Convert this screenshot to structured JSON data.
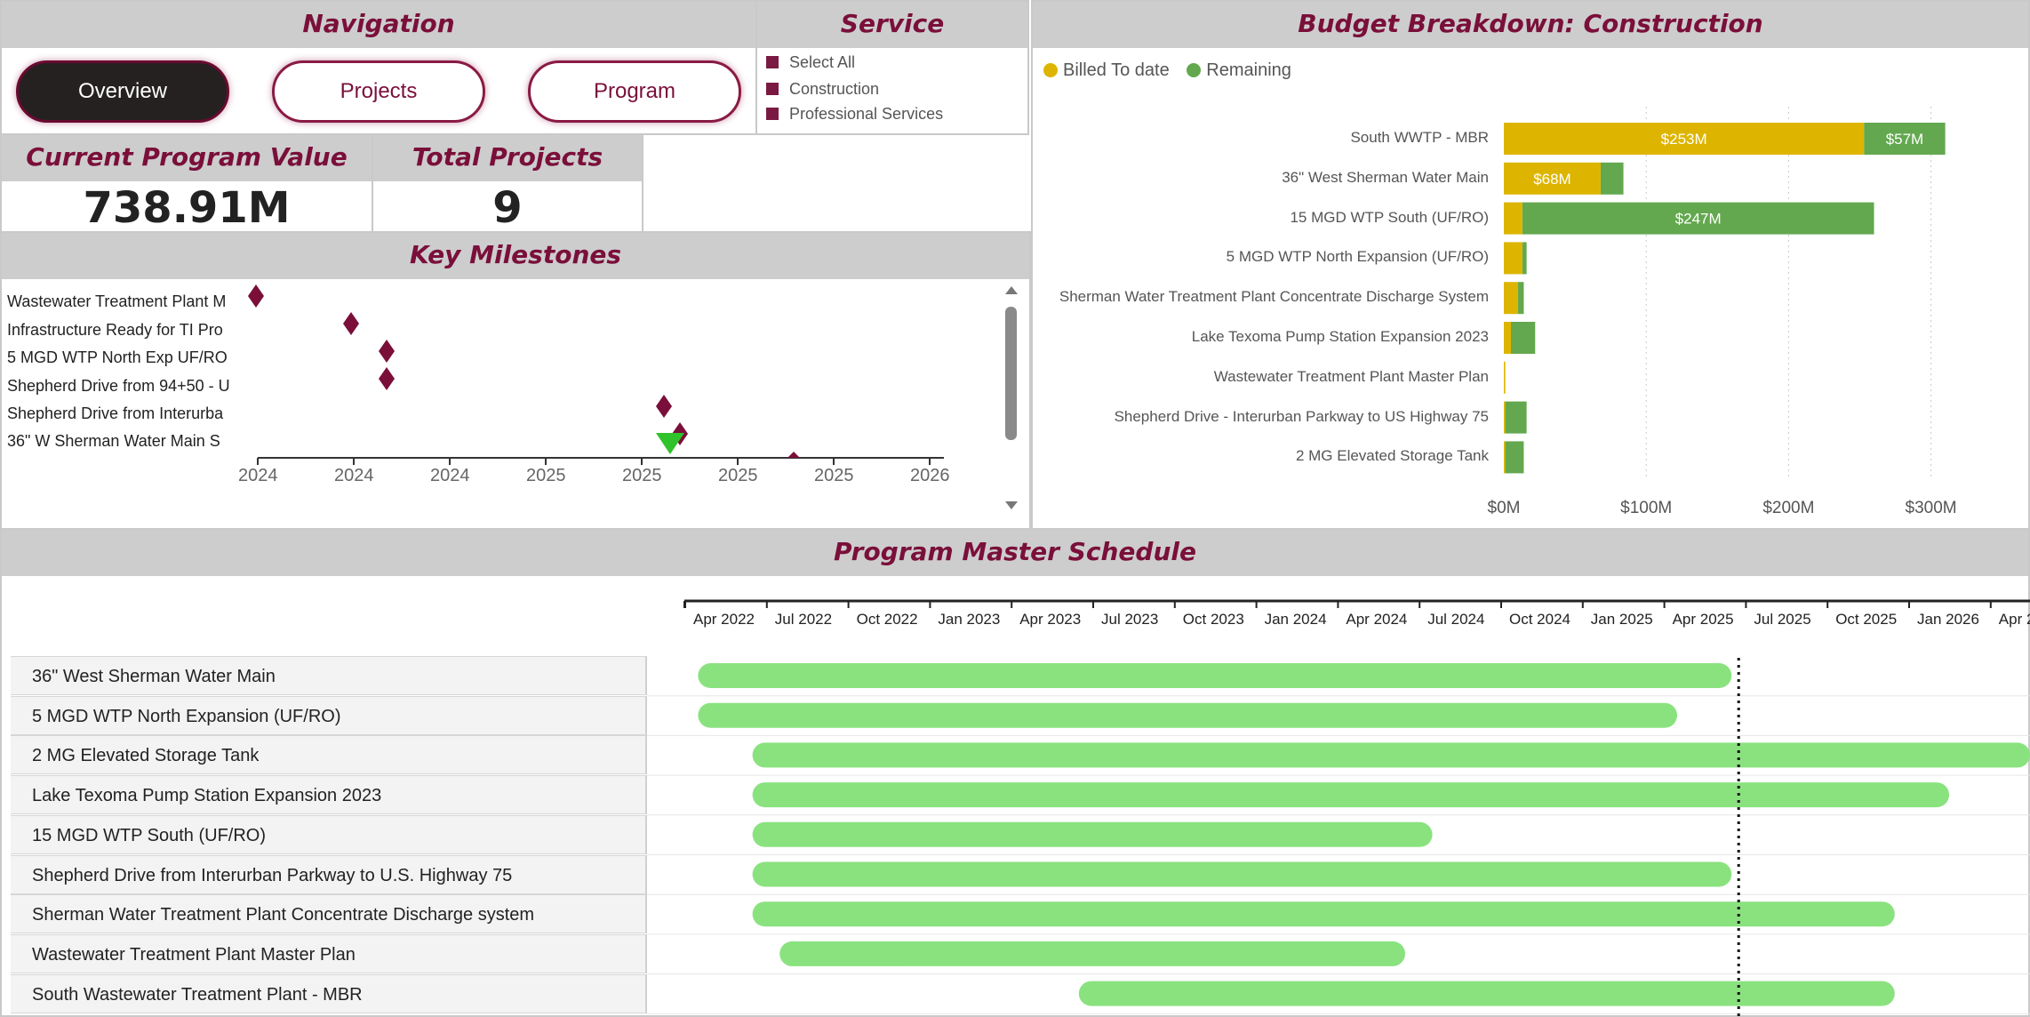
{
  "navigation": {
    "title": "Navigation",
    "buttons": [
      "Overview",
      "Projects",
      "Program"
    ],
    "active": "Overview"
  },
  "service": {
    "title": "Service",
    "items": [
      "Select All",
      "Construction",
      "Professional Services"
    ]
  },
  "kpis": {
    "program_value_title": "Current Program Value",
    "program_value": "738.91M",
    "total_projects_title": "Total Projects",
    "total_projects": "9"
  },
  "milestones": {
    "title": "Key Milestones",
    "labels": [
      "Wastewater Treatment Plant M",
      "Infrastructure Ready for TI Pro",
      "5 MGD WTP North Exp UF/RO",
      "Shepherd Drive from 94+50 - U",
      "Shepherd Drive from Interurba",
      "36\" W Sherman Water Main S"
    ],
    "ticks": [
      "2024",
      "2024",
      "2024",
      "2025",
      "2025",
      "2025",
      "2025",
      "2026"
    ]
  },
  "budget": {
    "title": "Budget Breakdown: Construction",
    "colors": {
      "billed": "#ddb500",
      "remaining": "#63a84f"
    },
    "chart_data": {
      "type": "bar",
      "orientation": "horizontal",
      "stacked": true,
      "categories": [
        "South WWTP - MBR",
        "36\" West Sherman Water Main",
        "15 MGD WTP South (UF/RO)",
        "5 MGD WTP North Expansion (UF/RO)",
        "Sherman Water Treatment Plant Concentrate Discharge System",
        "Lake Texoma Pump Station Expansion 2023",
        "Wastewater Treatment Plant Master Plan",
        "Shepherd Drive - Interurban Parkway to US Highway 75",
        "2 MG Elevated Storage Tank"
      ],
      "series": [
        {
          "name": "Billed To date",
          "values": [
            253,
            68,
            13,
            13,
            10,
            5,
            1,
            1,
            1
          ]
        },
        {
          "name": "Remaining",
          "values": [
            57,
            16,
            247,
            3,
            4,
            17,
            0,
            15,
            13
          ]
        }
      ],
      "data_labels": [
        [
          "$253M",
          "$57M"
        ],
        [
          "$68M",
          ""
        ],
        [
          "",
          "$247M"
        ],
        [
          "",
          ""
        ],
        [
          "",
          ""
        ],
        [
          "",
          ""
        ],
        [
          "",
          ""
        ],
        [
          "",
          ""
        ],
        [
          "",
          ""
        ]
      ],
      "xlim": [
        0,
        320
      ],
      "x_ticks": [
        "$0M",
        "$100M",
        "$200M",
        "$300M"
      ],
      "x_tick_values": [
        0,
        100,
        200,
        300
      ],
      "legend_position": "top-left",
      "grid": "vertical dotted"
    }
  },
  "schedule": {
    "title": "Program Master Schedule",
    "ticks": [
      "Apr 2022",
      "Jul 2022",
      "Oct 2022",
      "Jan 2023",
      "Apr 2023",
      "Jul 2023",
      "Oct 2023",
      "Jan 2024",
      "Apr 2024",
      "Jul 2024",
      "Oct 2024",
      "Jan 2025",
      "Apr 2025",
      "Jul 2025",
      "Oct 2025",
      "Jan 2026",
      "Apr 2"
    ],
    "rows": [
      {
        "label": "36\" West Sherman Water Main",
        "start": "2022-03",
        "end": "2025-05"
      },
      {
        "label": "5 MGD WTP North Expansion (UF/RO)",
        "start": "2022-03",
        "end": "2025-03"
      },
      {
        "label": "2 MG Elevated Storage Tank",
        "start": "2022-05",
        "end": "2026-05"
      },
      {
        "label": "Lake Texoma Pump Station Expansion 2023",
        "start": "2022-05",
        "end": "2026-01"
      },
      {
        "label": "15 MGD WTP South (UF/RO)",
        "start": "2022-05",
        "end": "2024-06"
      },
      {
        "label": "Shepherd Drive from Interurban Parkway to U.S. Highway 75",
        "start": "2022-05",
        "end": "2025-05"
      },
      {
        "label": "Sherman Water Treatment Plant Concentrate Discharge system",
        "start": "2022-05",
        "end": "2025-11"
      },
      {
        "label": "Wastewater Treatment Plant Master Plan",
        "start": "2022-06",
        "end": "2024-05"
      },
      {
        "label": "South Wastewater Treatment Plant - MBR",
        "start": "2023-05",
        "end": "2025-11"
      }
    ],
    "bar_color": "#8ae27f",
    "today": "2025-05"
  }
}
